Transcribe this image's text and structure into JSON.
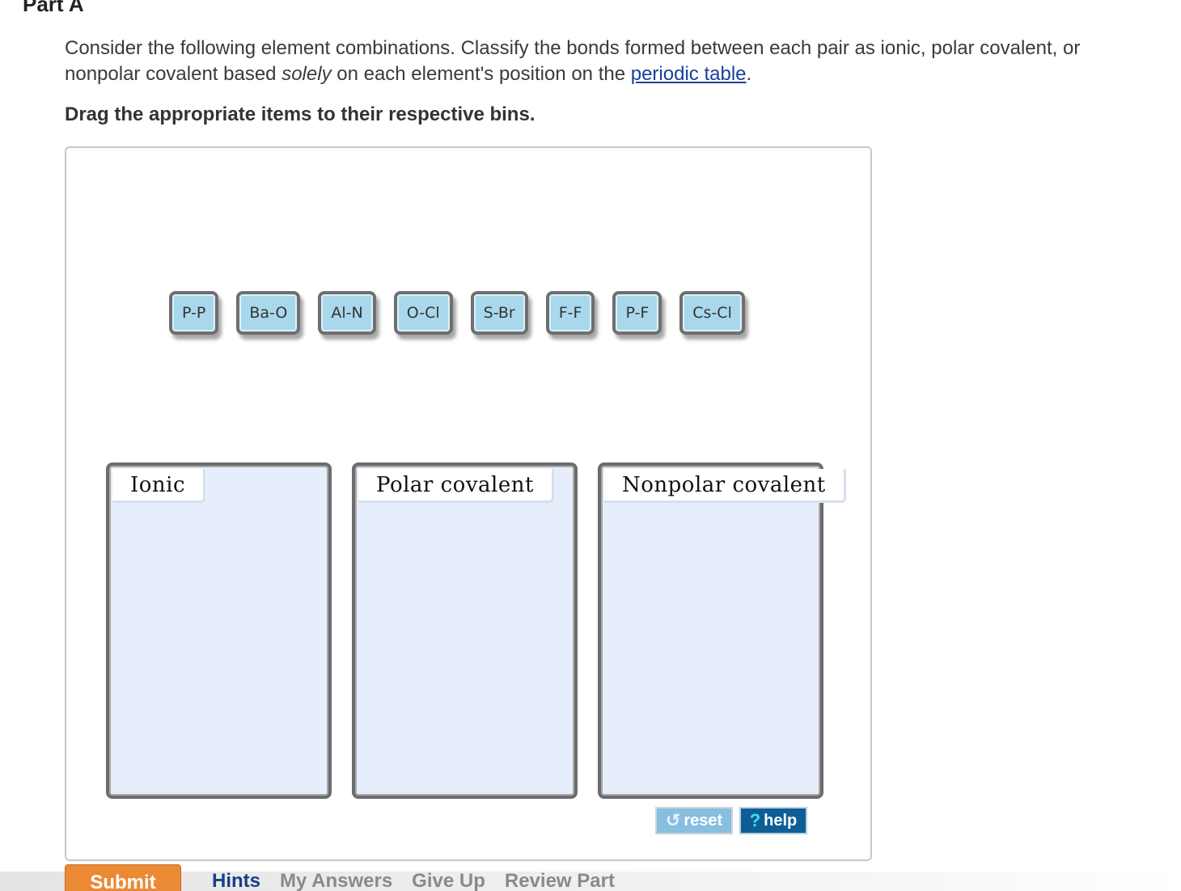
{
  "part": {
    "title": "Part A"
  },
  "question": {
    "text_before": "Consider the following element combinations. Classify the bonds formed between each pair as ionic, polar covalent, or nonpolar covalent based ",
    "emphasis": "solely",
    "text_middle": " on each element's position on the ",
    "link_text": "periodic table",
    "text_after": "."
  },
  "instruction": "Drag the appropriate items to their respective bins.",
  "tiles": [
    "P-P",
    "Ba-O",
    "Al-N",
    "O-Cl",
    "S-Br",
    "F-F",
    "P-F",
    "Cs-Cl"
  ],
  "bins": [
    {
      "label": "Ionic"
    },
    {
      "label": "Polar covalent"
    },
    {
      "label": "Nonpolar covalent"
    }
  ],
  "tools": {
    "reset_label": "reset",
    "help_label": "help",
    "help_glyph": "?"
  },
  "footer": {
    "submit_label": "Submit",
    "links": [
      "Hints",
      "My Answers",
      "Give Up",
      "Review Part"
    ]
  },
  "colors": {
    "tile_fill": "#a9d8ec",
    "bin_fill": "#e6eefb",
    "submit": "#ea8a35",
    "help": "#0e5e95",
    "reset": "#86bfe0",
    "link": "#1a3f9c"
  }
}
